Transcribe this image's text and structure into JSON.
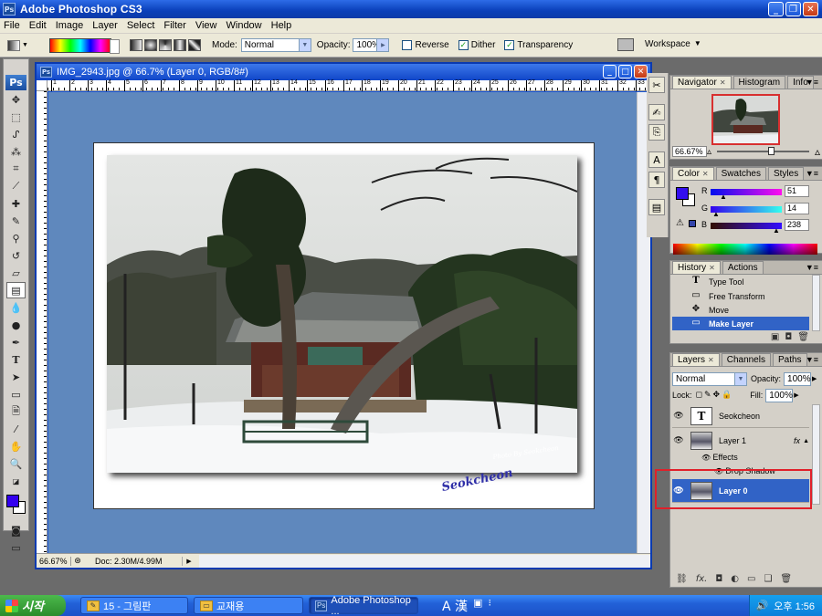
{
  "app": {
    "title": "Adobe Photoshop CS3",
    "icon_text": "Ps"
  },
  "menu": [
    "File",
    "Edit",
    "Image",
    "Layer",
    "Select",
    "Filter",
    "View",
    "Window",
    "Help"
  ],
  "options": {
    "mode_label": "Mode:",
    "mode_value": "Normal",
    "opacity_label": "Opacity:",
    "opacity_value": "100%",
    "reverse_label": "Reverse",
    "reverse_checked": false,
    "dither_label": "Dither",
    "dither_checked": true,
    "transparency_label": "Transparency",
    "transparency_checked": true,
    "workspace_label": "Workspace"
  },
  "document": {
    "title": "IMG_2943.jpg @ 66.7% (Layer 0, RGB/8#)",
    "zoom": "66.67%",
    "doc_size": "Doc: 2.30M/4.99M",
    "signature": "Seokcheon",
    "photo_credit": "Photo By Seokcheon",
    "ruler_labels": [
      "1",
      "2",
      "3",
      "4",
      "5",
      "6",
      "7",
      "8",
      "9",
      "10",
      "11",
      "12",
      "13",
      "14",
      "15",
      "16",
      "17",
      "18",
      "19",
      "20",
      "21",
      "22",
      "23",
      "24",
      "25",
      "26",
      "27",
      "28",
      "29",
      "30",
      "31",
      "32",
      "33"
    ]
  },
  "navigator": {
    "tabs": [
      "Navigator",
      "Histogram",
      "Info"
    ],
    "zoom": "66.67%"
  },
  "color": {
    "tabs": [
      "Color",
      "Swatches",
      "Styles"
    ],
    "r_label": "R",
    "r": "51",
    "g_label": "G",
    "g": "14",
    "b_label": "B",
    "b": "238",
    "foreground": "#330EEE"
  },
  "history": {
    "tabs": [
      "History",
      "Actions"
    ],
    "items": [
      {
        "label": "Type Tool",
        "icon": "T"
      },
      {
        "label": "Free Transform",
        "icon": "▭"
      },
      {
        "label": "Move",
        "icon": "✥"
      },
      {
        "label": "Make Layer",
        "icon": "▭"
      }
    ]
  },
  "layers": {
    "tabs": [
      "Layers",
      "Channels",
      "Paths"
    ],
    "blend": "Normal",
    "opacity_label": "Opacity:",
    "opacity": "100%",
    "lock_label": "Lock:",
    "fill_label": "Fill:",
    "fill": "100%",
    "items": [
      {
        "name": "Seokcheon",
        "thumb": "T"
      },
      {
        "name": "Layer 1",
        "thumb": ""
      },
      {
        "name": "Layer 0",
        "thumb": ""
      }
    ],
    "effects_label": "Effects",
    "drop_shadow_label": "Drop Shadow",
    "fx": "fx"
  },
  "taskbar": {
    "start": "시작",
    "items": [
      "15 - 그림판",
      "교재용",
      "Adobe Photoshop ..."
    ],
    "ime": "A 漢",
    "clock": "오후 1:56"
  }
}
